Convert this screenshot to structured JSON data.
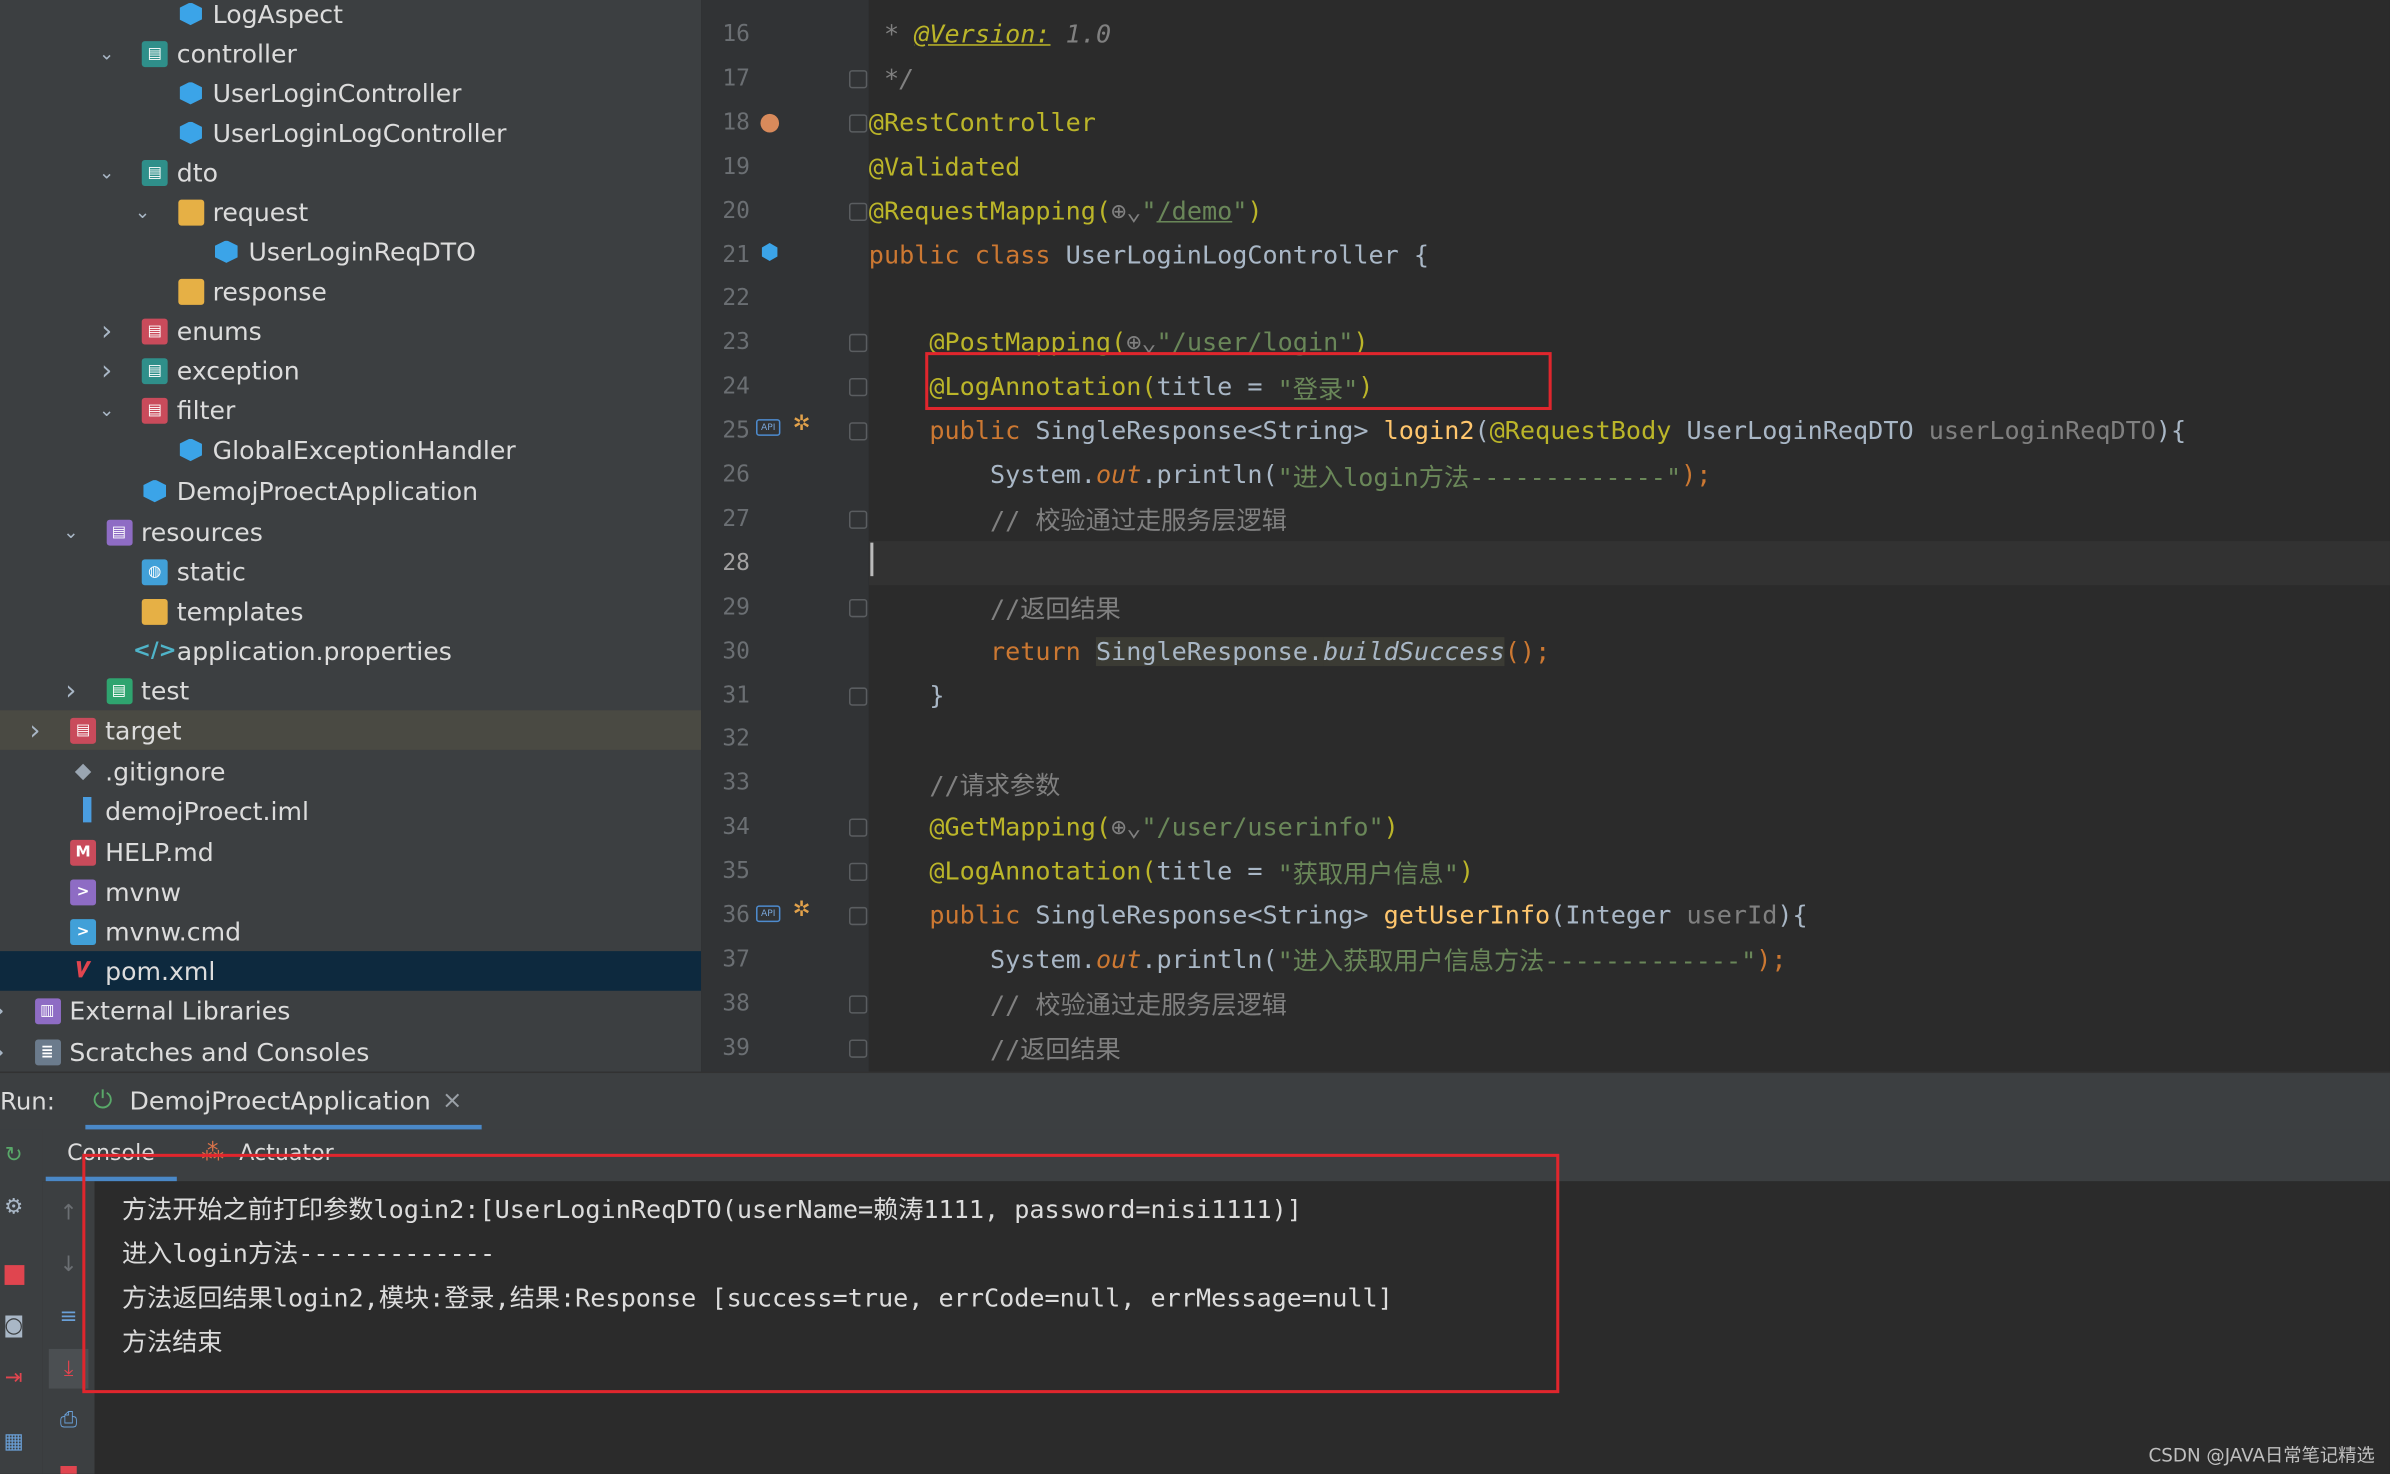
{
  "tree": [
    {
      "label": "LogAspect",
      "icon": "class-icon",
      "depth": 3
    },
    {
      "label": "controller",
      "icon": "package-icon",
      "depth": 2,
      "expanded": true
    },
    {
      "label": "UserLoginController",
      "icon": "class-icon",
      "depth": 3
    },
    {
      "label": "UserLoginLogController",
      "icon": "class-icon",
      "depth": 3
    },
    {
      "label": "dto",
      "icon": "package-icon",
      "depth": 2,
      "expanded": true
    },
    {
      "label": "request",
      "icon": "folder-icon",
      "depth": 3,
      "expanded": true
    },
    {
      "label": "UserLoginReqDTO",
      "icon": "class-icon",
      "depth": 4
    },
    {
      "label": "response",
      "icon": "folder-icon",
      "depth": 3
    },
    {
      "label": "enums",
      "icon": "package-icon",
      "depth": 2,
      "expanded": false
    },
    {
      "label": "exception",
      "icon": "package-icon",
      "depth": 2,
      "expanded": false
    },
    {
      "label": "filter",
      "icon": "package-icon",
      "depth": 2,
      "expanded": true
    },
    {
      "label": "GlobalExceptionHandler",
      "icon": "class-icon",
      "depth": 3
    },
    {
      "label": "DemojProectApplication",
      "icon": "spring-class-icon",
      "depth": 2
    },
    {
      "label": "resources",
      "icon": "resources-folder-icon",
      "depth": 1,
      "expanded": true
    },
    {
      "label": "static",
      "icon": "web-folder-icon",
      "depth": 2
    },
    {
      "label": "templates",
      "icon": "folder-icon",
      "depth": 2
    },
    {
      "label": "application.properties",
      "icon": "properties-icon",
      "depth": 2
    },
    {
      "label": "test",
      "icon": "test-folder-icon",
      "depth": 1,
      "expanded": false
    },
    {
      "label": "target",
      "icon": "excluded-folder-icon",
      "depth": 0,
      "expanded": false
    },
    {
      "label": ".gitignore",
      "icon": "git-icon",
      "depth": 0
    },
    {
      "label": "demojProect.iml",
      "icon": "iml-icon",
      "depth": 0
    },
    {
      "label": "HELP.md",
      "icon": "markdown-icon",
      "depth": 0
    },
    {
      "label": "mvnw",
      "icon": "shell-icon",
      "depth": 0
    },
    {
      "label": "mvnw.cmd",
      "icon": "cmd-icon",
      "depth": 0
    },
    {
      "label": "pom.xml",
      "icon": "maven-icon",
      "depth": 0
    },
    {
      "label": "External Libraries",
      "icon": "library-icon",
      "depth": -1,
      "expanded": false
    },
    {
      "label": "Scratches and Consoles",
      "icon": "scratches-icon",
      "depth": -1,
      "expanded": false
    }
  ],
  "editor": {
    "line_numbers": [
      "16",
      "17",
      "18",
      "19",
      "20",
      "21",
      "22",
      "23",
      "24",
      "25",
      "26",
      "27",
      "28",
      "29",
      "30",
      "31",
      "32",
      "33",
      "34",
      "35",
      "36",
      "37",
      "38",
      "39"
    ],
    "current_line": "28",
    "lines": [
      [
        {
          "t": " * ",
          "c": "c i"
        },
        {
          "t": "@Version:",
          "c": "a i u"
        },
        {
          "t": " 1.0",
          "c": "c i"
        }
      ],
      [
        {
          "t": " */",
          "c": "c i"
        }
      ],
      [
        {
          "t": "@RestController",
          "c": "a"
        }
      ],
      [
        {
          "t": "@Validated",
          "c": "a"
        }
      ],
      [
        {
          "t": "@RequestMapping(",
          "c": "a"
        },
        {
          "t": "⊕⌄",
          "c": "p"
        },
        {
          "t": "\"",
          "c": "s"
        },
        {
          "t": "/demo",
          "c": "s u"
        },
        {
          "t": "\"",
          "c": "s"
        },
        {
          "t": ")",
          "c": "a"
        }
      ],
      [
        {
          "t": "public class ",
          "c": "k"
        },
        {
          "t": "UserLoginLogController {",
          "c": ""
        }
      ],
      [],
      [
        {
          "t": "    @PostMapping(",
          "c": "a"
        },
        {
          "t": "⊕⌄",
          "c": "p"
        },
        {
          "t": "\"/user/login\"",
          "c": "s"
        },
        {
          "t": ")",
          "c": "a"
        }
      ],
      [
        {
          "t": "    @LogAnnotation(",
          "c": "a"
        },
        {
          "t": "title = ",
          "c": ""
        },
        {
          "t": "\"登录\"",
          "c": "s"
        },
        {
          "t": ")",
          "c": "a"
        }
      ],
      [
        {
          "t": "    public ",
          "c": "k"
        },
        {
          "t": "SingleResponse<String> ",
          "c": ""
        },
        {
          "t": "login2",
          "c": "f"
        },
        {
          "t": "(",
          "c": ""
        },
        {
          "t": "@RequestBody ",
          "c": "a"
        },
        {
          "t": "UserLoginReqDTO ",
          "c": ""
        },
        {
          "t": "userLoginReqDTO",
          "c": "p"
        },
        {
          "t": "){",
          "c": ""
        }
      ],
      [
        {
          "t": "        System.",
          "c": ""
        },
        {
          "t": "out",
          "c": "k i"
        },
        {
          "t": ".println(",
          "c": ""
        },
        {
          "t": "\"进入login方法-------------\"",
          "c": "s"
        },
        {
          "t": ");",
          "c": "k"
        }
      ],
      [
        {
          "t": "        // 校验通过走服务层逻辑",
          "c": "c"
        }
      ],
      [],
      [
        {
          "t": "        //返回结果",
          "c": "c"
        }
      ],
      [
        {
          "t": "        return ",
          "c": "k"
        },
        {
          "t": "SingleResponse.",
          "c": ""
        },
        {
          "t": "buildSuccess",
          "c": "i"
        },
        {
          "t": "();",
          "c": "k"
        }
      ],
      [
        {
          "t": "    }",
          "c": ""
        }
      ],
      [],
      [
        {
          "t": "    //请求参数",
          "c": "c"
        }
      ],
      [
        {
          "t": "    @GetMapping(",
          "c": "a"
        },
        {
          "t": "⊕⌄",
          "c": "p"
        },
        {
          "t": "\"/user/userinfo\"",
          "c": "s"
        },
        {
          "t": ")",
          "c": "a"
        }
      ],
      [
        {
          "t": "    @LogAnnotation(",
          "c": "a"
        },
        {
          "t": "title = ",
          "c": ""
        },
        {
          "t": "\"获取用户信息\"",
          "c": "s"
        },
        {
          "t": ")",
          "c": "a"
        }
      ],
      [
        {
          "t": "    public ",
          "c": "k"
        },
        {
          "t": "SingleResponse<String> ",
          "c": ""
        },
        {
          "t": "getUserInfo",
          "c": "f"
        },
        {
          "t": "(",
          "c": ""
        },
        {
          "t": "Integer ",
          "c": ""
        },
        {
          "t": "userId",
          "c": "p"
        },
        {
          "t": "){",
          "c": ""
        }
      ],
      [
        {
          "t": "        System.",
          "c": ""
        },
        {
          "t": "out",
          "c": "k i"
        },
        {
          "t": ".println(",
          "c": ""
        },
        {
          "t": "\"进入获取用户信息方法-------------\"",
          "c": "s"
        },
        {
          "t": ");",
          "c": "k"
        }
      ],
      [
        {
          "t": "        // 校验通过走服务层逻辑",
          "c": "c"
        }
      ],
      [
        {
          "t": "        //返回结果",
          "c": "c"
        }
      ]
    ]
  },
  "run": {
    "label": "Run:",
    "config_name": "DemojProectApplication",
    "close": "×",
    "tabs": [
      "Console",
      "Actuator"
    ],
    "output": [
      "方法开始之前打印参数login2:[UserLoginReqDTO(userName=赖涛1111, password=nisi1111)]",
      "进入login方法-------------",
      "方法返回结果login2,模块:登录,结果:Response [success=true, errCode=null, errMessage=null]",
      "方法结束"
    ]
  },
  "watermark": "CSDN @JAVA日常笔记精选",
  "colors": {
    "annotation_box": "#e0262d",
    "selection": "#0d293e"
  }
}
